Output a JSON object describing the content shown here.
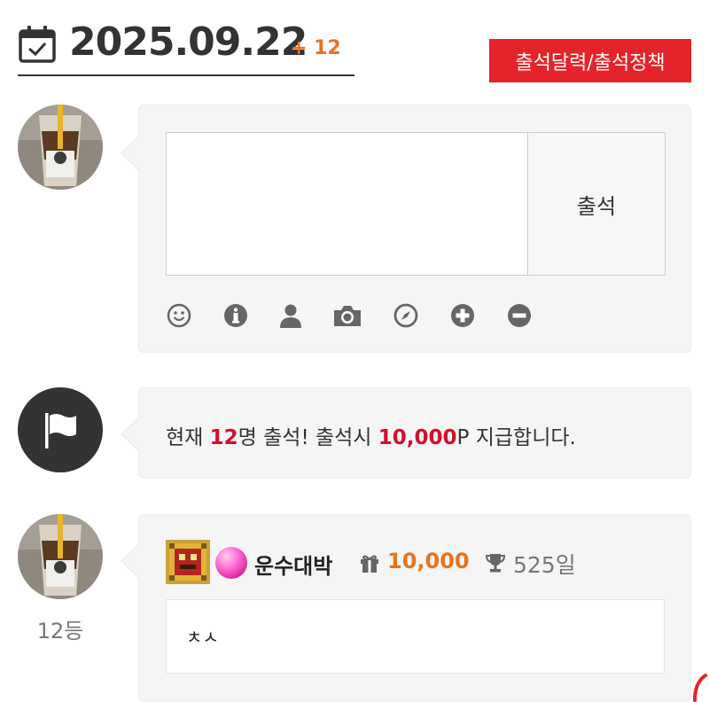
{
  "header": {
    "date": "2025.09.22",
    "count_badge": "+ 12",
    "policy_button": "출석달력/출석정책",
    "calendar_icon": "calendar-check-icon"
  },
  "compose": {
    "textarea_placeholder": "",
    "submit_label": "출석",
    "toolbar_icons": [
      "smile-icon",
      "info-icon",
      "user-icon",
      "camera-icon",
      "compass-icon",
      "plus-circle-icon",
      "minus-circle-icon"
    ]
  },
  "notice": {
    "prefix": "현재 ",
    "count": "12",
    "middle": "명 출석! 출석시 ",
    "points": "10,000",
    "suffix": "P 지급합니다."
  },
  "entry": {
    "rank": "12등",
    "nickname": "운수대박",
    "points": "10,000",
    "days": "525일",
    "comment": "ㅊㅅ"
  },
  "colors": {
    "accent_red": "#e5232b",
    "points_orange": "#e8731e",
    "notice_red": "#d0102a"
  }
}
